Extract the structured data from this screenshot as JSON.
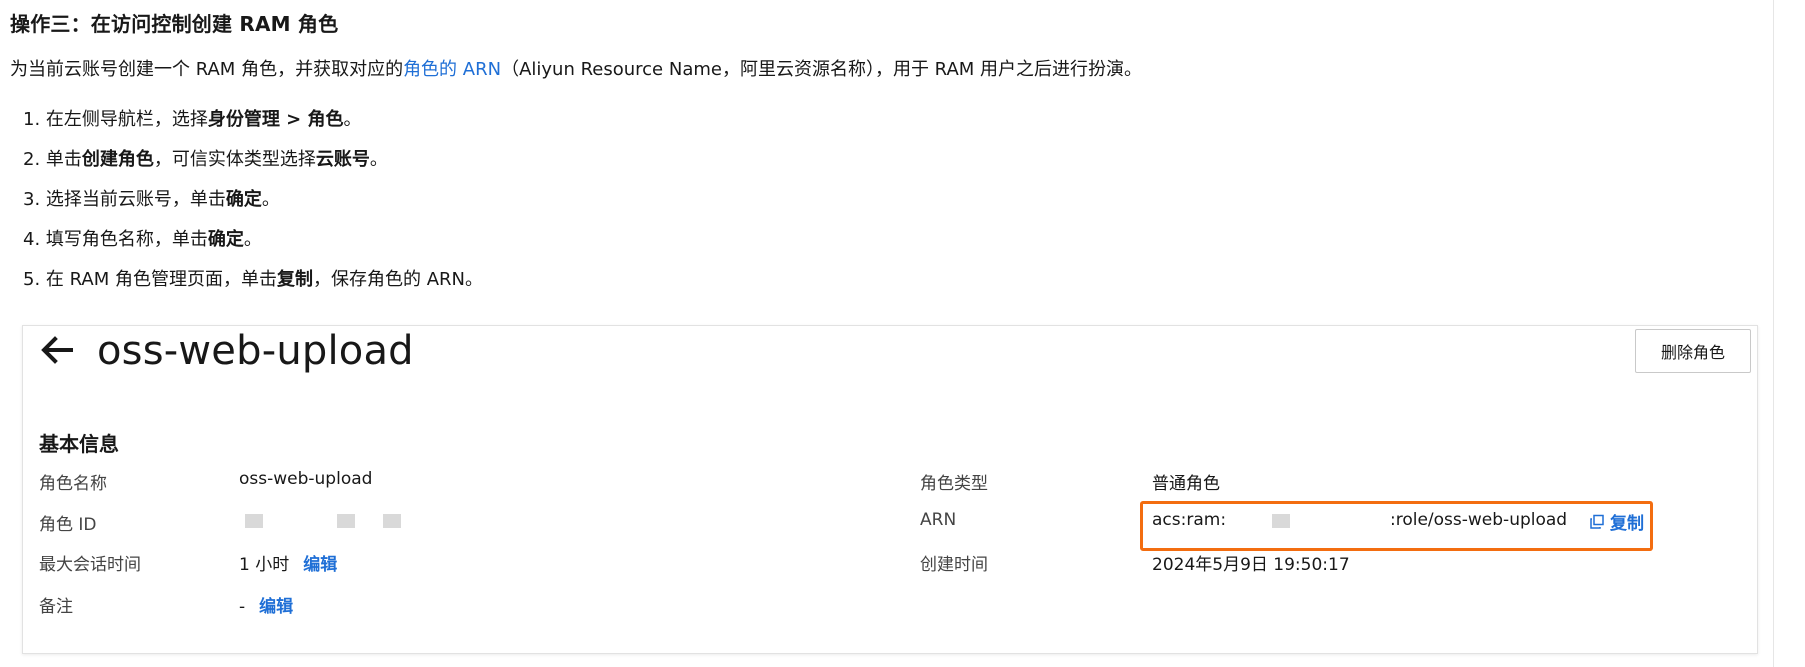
{
  "doc": {
    "heading": "操作三：在访问控制创建 RAM 角色",
    "intro": {
      "before": "为当前云账号创建一个 RAM 角色，并获取对应的",
      "link": "角色的 ARN",
      "after": "（Aliyun Resource Name，阿里云资源名称），用于 RAM 用户之后进行扮演。"
    },
    "steps": [
      {
        "pre": "1. 在左侧导航栏，选择",
        "bold": "身份管理 > 角色",
        "post": "。"
      },
      {
        "pre": "2. 单击",
        "bold": "创建角色",
        "mid": "，可信实体类型选择",
        "bold2": "云账号",
        "post": "。"
      },
      {
        "pre": "3. 选择当前云账号，单击",
        "bold": "确定",
        "post": "。"
      },
      {
        "pre": "4. 填写角色名称，单击",
        "bold": "确定",
        "post": "。"
      },
      {
        "pre": "5. 在 RAM 角色管理页面，单击",
        "bold": "复制",
        "post": "，保存角色的 ARN。"
      }
    ]
  },
  "panel": {
    "title": "oss-web-upload",
    "delete_button": "删除角色",
    "section": "基本信息",
    "fields": {
      "role_name_label": "角色名称",
      "role_name_value": "oss-web-upload",
      "role_id_label": "角色 ID",
      "session_label": "最大会话时间",
      "session_value": "1 小时",
      "note_label": "备注",
      "note_value": "-",
      "edit": "编辑",
      "role_type_label": "角色类型",
      "role_type_value": "普通角色",
      "arn_label": "ARN",
      "arn_prefix": "acs:ram:",
      "arn_suffix": ":role/oss-web-upload",
      "copy": "复制",
      "created_label": "创建时间",
      "created_value": "2024年5月9日 19:50:17"
    }
  },
  "colors": {
    "link": "#1f6fd6",
    "highlight": "#f36d10"
  },
  "icons": {
    "back": "arrow-left-icon",
    "copy": "copy-icon"
  }
}
